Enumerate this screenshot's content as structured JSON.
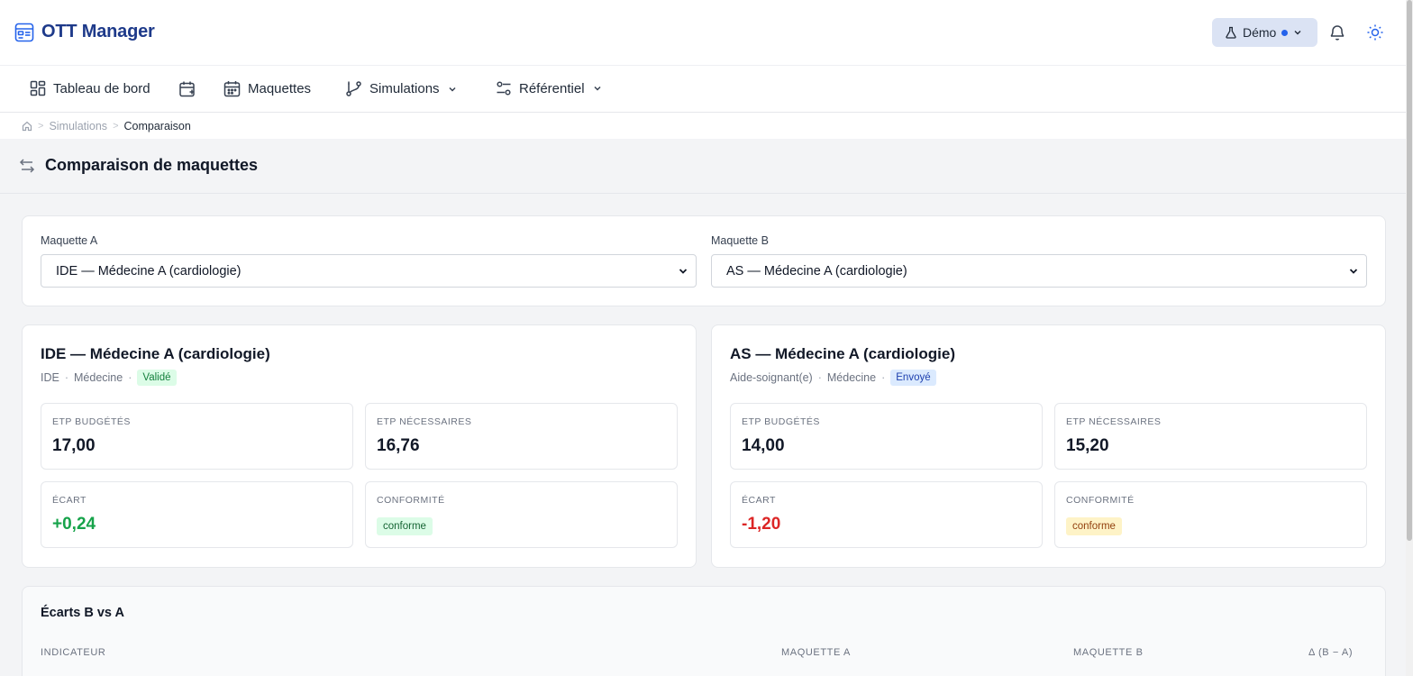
{
  "app": {
    "name": "OTT Manager"
  },
  "header": {
    "demo_label": "Démo"
  },
  "nav": {
    "dashboard": "Tableau de bord",
    "maquettes": "Maquettes",
    "simulations": "Simulations",
    "referentiel": "Référentiel"
  },
  "breadcrumb": {
    "simulations": "Simulations",
    "current": "Comparaison"
  },
  "page": {
    "title": "Comparaison de maquettes"
  },
  "selectors": {
    "a_label": "Maquette A",
    "a_value": "IDE — Médecine A (cardiologie)",
    "b_label": "Maquette B",
    "b_value": "AS — Médecine A (cardiologie)"
  },
  "maquette_a": {
    "title": "IDE — Médecine A (cardiologie)",
    "role": "IDE",
    "service": "Médecine",
    "status": "Validé",
    "etp_budget_label": "ETP budgétés",
    "etp_budget": "17,00",
    "etp_needed_label": "ETP nécessaires",
    "etp_needed": "16,76",
    "ecart_label": "Écart",
    "ecart": "+0,24",
    "conformite_label": "Conformité",
    "conformite": "conforme"
  },
  "maquette_b": {
    "title": "AS — Médecine A (cardiologie)",
    "role": "Aide-soignant(e)",
    "service": "Médecine",
    "status": "Envoyé",
    "etp_budget_label": "ETP budgétés",
    "etp_budget": "14,00",
    "etp_needed_label": "ETP nécessaires",
    "etp_needed": "15,20",
    "ecart_label": "Écart",
    "ecart": "-1,20",
    "conformite_label": "Conformité",
    "conformite": "conforme"
  },
  "ecarts": {
    "title": "Écarts B vs A",
    "col_indicator": "Indicateur",
    "col_a": "Maquette A",
    "col_b": "Maquette B",
    "col_delta": "Δ (B − A)"
  },
  "colors": {
    "positive": "#16a34a",
    "negative": "#dc2626",
    "accent": "#1e3a8a"
  }
}
